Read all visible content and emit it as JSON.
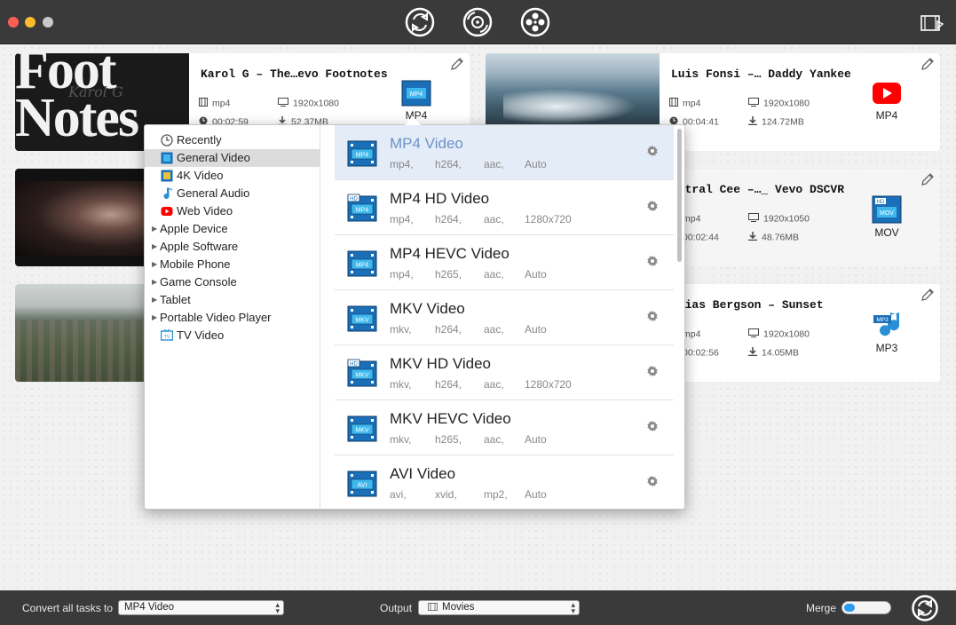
{
  "colors": {
    "accent": "#6c93c8",
    "titlebar": "#3a3a3a",
    "youtube_red": "#ff0000",
    "toggle_blue": "#2d9bf0"
  },
  "toolbar": {
    "icons": [
      "convert-icon",
      "rip-dvd-icon",
      "download-video-icon",
      "toolbox-icon"
    ]
  },
  "tasks": [
    {
      "title": "Karol G – The…evo Footnotes",
      "container": "mp4",
      "resolution": "1920x1080",
      "duration": "00:02:59",
      "size": "52.37MB",
      "format_label": "MP4",
      "format_icon": "mp4-film-icon",
      "thumb_text": "Foot Notes",
      "thumb_sub": "Karol G"
    },
    {
      "title": "Luis Fonsi –… Daddy Yankee",
      "container": "mp4",
      "resolution": "1920x1080",
      "duration": "00:04:41",
      "size": "124.72MB",
      "format_label": "MP4",
      "format_icon": "youtube-icon"
    },
    {
      "title": "…ntral Cee –…_ Vevo DSCVR",
      "container": "mp4",
      "resolution": "1920x1050",
      "duration": "00:02:44",
      "size": "48.76MB",
      "format_label": "MOV",
      "format_icon": "hd-mov-film-icon"
    },
    {
      "title": "…bias Bergson – Sunset",
      "container": "mp4",
      "resolution": "1920x1080",
      "duration": "00:02:56",
      "size": "14.05MB",
      "format_label": "MP3",
      "format_icon": "mp3-note-icon"
    }
  ],
  "categories": [
    {
      "label": "Recently",
      "icon": "clock-icon",
      "expandable": false
    },
    {
      "label": "General Video",
      "icon": "film-icon",
      "expandable": false,
      "selected": true
    },
    {
      "label": "4K Video",
      "icon": "film-4k-icon",
      "expandable": false
    },
    {
      "label": "General Audio",
      "icon": "music-note-icon",
      "expandable": false
    },
    {
      "label": "Web Video",
      "icon": "youtube-icon",
      "expandable": false
    },
    {
      "label": "Apple Device",
      "expandable": true
    },
    {
      "label": "Apple Software",
      "expandable": true
    },
    {
      "label": "Mobile Phone",
      "expandable": true
    },
    {
      "label": "Game Console",
      "expandable": true
    },
    {
      "label": "Tablet",
      "expandable": true
    },
    {
      "label": "Portable Video Player",
      "expandable": true
    },
    {
      "label": "TV Video",
      "icon": "tv-icon",
      "expandable": false
    }
  ],
  "formats": [
    {
      "name": "MP4 Video",
      "badge": "MP4",
      "hd": false,
      "specs": [
        "mp4,",
        "h264,",
        "aac,",
        "Auto"
      ],
      "selected": true
    },
    {
      "name": "MP4 HD Video",
      "badge": "MP4",
      "hd": true,
      "specs": [
        "mp4,",
        "h264,",
        "aac,",
        "1280x720"
      ]
    },
    {
      "name": "MP4 HEVC Video",
      "badge": "MP4",
      "hd": false,
      "specs": [
        "mp4,",
        "h265,",
        "aac,",
        "Auto"
      ]
    },
    {
      "name": "MKV Video",
      "badge": "MKV",
      "hd": false,
      "specs": [
        "mkv,",
        "h264,",
        "aac,",
        "Auto"
      ]
    },
    {
      "name": "MKV HD Video",
      "badge": "MKV",
      "hd": true,
      "specs": [
        "mkv,",
        "h264,",
        "aac,",
        "1280x720"
      ]
    },
    {
      "name": "MKV HEVC Video",
      "badge": "MKV",
      "hd": false,
      "specs": [
        "mkv,",
        "h265,",
        "aac,",
        "Auto"
      ]
    },
    {
      "name": "AVI Video",
      "badge": "AVI",
      "hd": false,
      "specs": [
        "avi,",
        "xvid,",
        "mp2,",
        "Auto"
      ]
    }
  ],
  "footer": {
    "convert_label": "Convert all tasks to",
    "convert_value": "MP4 Video",
    "output_label": "Output",
    "output_value": "Movies",
    "merge_label": "Merge",
    "merge_on": true
  }
}
